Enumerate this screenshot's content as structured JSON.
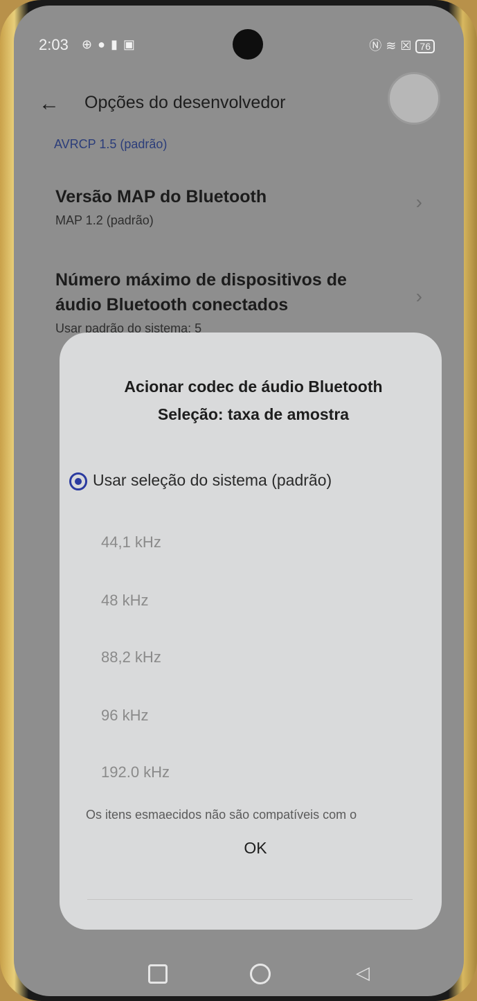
{
  "status_bar": {
    "time": "2:03",
    "left_icons": [
      "vpn-icon",
      "bug-icon",
      "sim-icon",
      "notification-icon"
    ],
    "right_icons": [
      "nfc-icon",
      "wifi-icon",
      "x-box-icon"
    ],
    "battery": "76"
  },
  "header": {
    "title": "Opções do desenvolvedor"
  },
  "settings": {
    "prev_subtitle": "AVRCP 1.5 (padrão)",
    "map_version": {
      "title": "Versão MAP do Bluetooth",
      "subtitle": "MAP 1.2 (padrão)"
    },
    "max_devices": {
      "title_line1": "Número máximo de dispositivos de",
      "title_line2": "áudio Bluetooth conectados",
      "subtitle": "Usar padrão do sistema: 5"
    }
  },
  "dialog": {
    "title_line1": "Acionar codec de áudio Bluetooth",
    "title_line2": "Seleção: taxa de amostra",
    "options": [
      {
        "label": "Usar seleção do sistema (padrão)",
        "selected": true
      },
      {
        "label": "44,1 kHz",
        "selected": false
      },
      {
        "label": "48 kHz",
        "selected": false
      },
      {
        "label": "88,2 kHz",
        "selected": false
      },
      {
        "label": "96 kHz",
        "selected": false
      },
      {
        "label": "192.0 kHz",
        "selected": false
      }
    ],
    "footnote": "Os itens esmaecidos não são compatíveis com o",
    "ok_label": "OK"
  },
  "colors": {
    "accent": "#2a3aa0",
    "screen_dim": "#8e8e8e",
    "dialog_bg": "#d9dadb"
  }
}
